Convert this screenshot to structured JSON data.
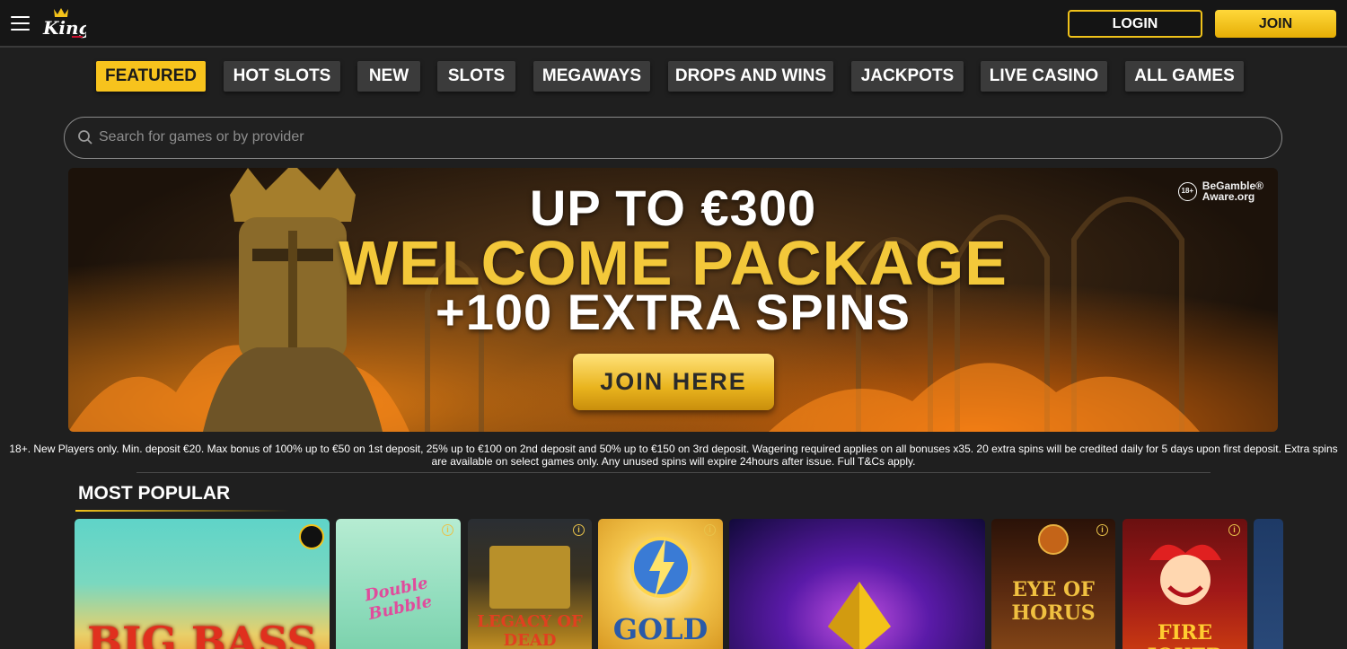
{
  "header": {
    "logo_text": "King",
    "login_label": "LOGIN",
    "join_label": "JOIN"
  },
  "nav": {
    "tabs": [
      {
        "label": "FEATURED",
        "active": true
      },
      {
        "label": "HOT SLOTS"
      },
      {
        "label": "NEW"
      },
      {
        "label": "SLOTS"
      },
      {
        "label": "MEGAWAYS"
      },
      {
        "label": "DROPS AND WINS"
      },
      {
        "label": "JACKPOTS"
      },
      {
        "label": "LIVE CASINO"
      },
      {
        "label": "ALL GAMES"
      }
    ]
  },
  "search": {
    "placeholder": "Search for games or by provider",
    "value": ""
  },
  "banner": {
    "line1": "UP TO €300",
    "line2": "WELCOME PACKAGE",
    "line3": "+100 EXTRA SPINS",
    "cta_label": "JOIN HERE",
    "age_badge": "18+",
    "bga_line1": "BeGamble®",
    "bga_line2": "Aware.org"
  },
  "terms": "18+. New Players only. Min. deposit €20. Max bonus of 100% up to €50 on 1st deposit, 25% up to €100 on 2nd deposit and 50% up to €150 on 3rd deposit. Wagering required applies on all bonuses x35. 20 extra spins will be credited daily for 5 days upon first deposit. Extra spins are available on select games only. Any unused spins will expire 24hours after issue. Full T&Cs apply.",
  "most_popular": {
    "title": "MOST POPULAR",
    "games": [
      {
        "title": "BIG BASS"
      },
      {
        "title": "Double Bubble"
      },
      {
        "title": "LEGACY OF DEAD"
      },
      {
        "title": "GOLD"
      },
      {
        "title": ""
      },
      {
        "title": "EYE OF HORUS"
      },
      {
        "title": "FIRE JOKER"
      }
    ],
    "info_glyph": "i"
  },
  "colors": {
    "accent": "#f7c31d",
    "background": "#1f1f1f",
    "tab_bg": "#3b3b3b"
  }
}
